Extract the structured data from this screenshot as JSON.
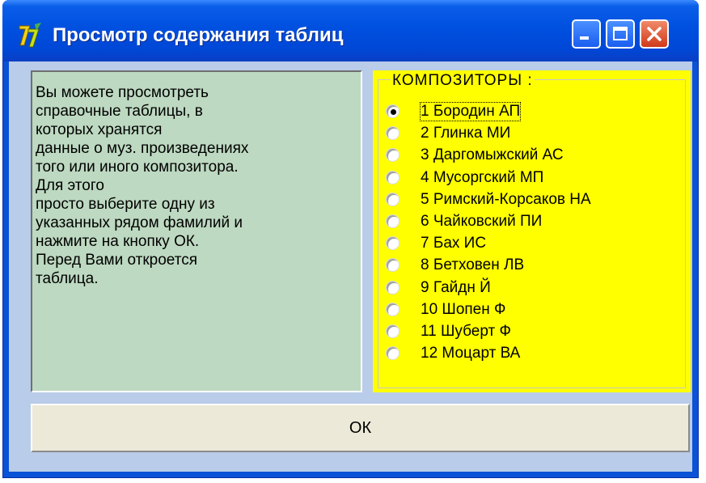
{
  "window": {
    "title": "Просмотр содержания таблиц",
    "colors": {
      "titlebar": "#0050e0",
      "client": "#b9cce9",
      "info_bg": "#bdd9c1",
      "group_bg": "#ffff00",
      "close": "#d03a1a"
    }
  },
  "info": {
    "text": "Вы можете просмотреть\nсправочные таблицы, в\nкоторых хранятся\nданные о муз. произведениях\nтого или иного композитора.\nДля этого\nпросто выберите одну из\nуказанных рядом фамилий и\nнажмите на  кнопку ОК.\nПеред Вами откроется\nтаблица."
  },
  "composers": {
    "title": "КОМПОЗИТОРЫ :",
    "selected_index": 0,
    "items": [
      "1 Бородин АП",
      "2 Глинка МИ",
      "3 Даргомыжский АС",
      "4 Мусоргский МП",
      "5 Римский-Корсаков НА",
      "6 Чайковский ПИ",
      "7 Бах ИС",
      "8 Бетховен ЛВ",
      "9 Гайдн Й",
      "10 Шопен Ф",
      "11 Шуберт Ф",
      "12 Моцарт ВА"
    ]
  },
  "buttons": {
    "ok_label": "ОК"
  },
  "icons": {
    "app": "app-logo-icon",
    "minimize": "minimize-icon",
    "maximize": "maximize-icon",
    "close": "close-icon"
  }
}
